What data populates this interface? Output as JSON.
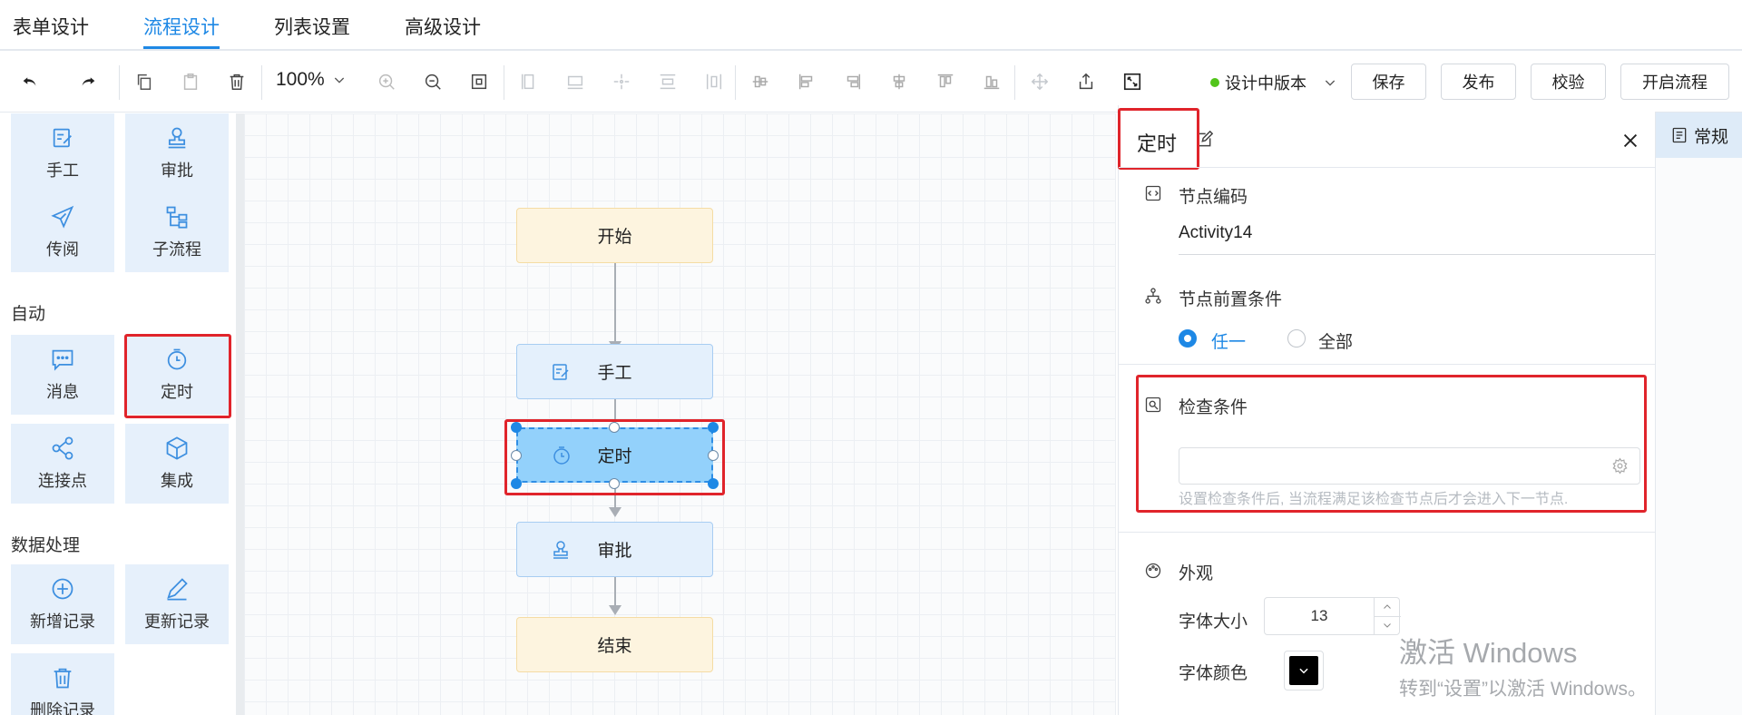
{
  "tabs": [
    {
      "label": "表单设计"
    },
    {
      "label": "流程设计"
    },
    {
      "label": "列表设置"
    },
    {
      "label": "高级设计"
    }
  ],
  "toolbar": {
    "zoom": "100%",
    "version": "设计中版本",
    "buttons": [
      "保存",
      "发布",
      "校验",
      "开启流程"
    ]
  },
  "palette": {
    "items_top": [
      {
        "label": "手工",
        "icon": "edit-icon"
      },
      {
        "label": "审批",
        "icon": "stamp-icon"
      },
      {
        "label": "传阅",
        "icon": "send-icon"
      },
      {
        "label": "子流程",
        "icon": "subflow-icon"
      }
    ],
    "section_auto": "自动",
    "items_auto": [
      {
        "label": "消息",
        "icon": "message-icon"
      },
      {
        "label": "定时",
        "icon": "timer-icon"
      },
      {
        "label": "连接点",
        "icon": "share-icon"
      },
      {
        "label": "集成",
        "icon": "cube-icon"
      }
    ],
    "section_data": "数据处理",
    "items_data": [
      {
        "label": "新增记录",
        "icon": "plus-circle-icon"
      },
      {
        "label": "更新记录",
        "icon": "pen-icon"
      },
      {
        "label": "删除记录",
        "icon": "trash-icon"
      }
    ]
  },
  "flow": {
    "nodes": [
      {
        "label": "开始"
      },
      {
        "label": "手工"
      },
      {
        "label": "定时"
      },
      {
        "label": "审批"
      },
      {
        "label": "结束"
      }
    ]
  },
  "panel": {
    "title": "定时",
    "code_label": "节点编码",
    "code_value": "Activity14",
    "precondition_label": "节点前置条件",
    "option_any": "任一",
    "option_all": "全部",
    "check_label": "检查条件",
    "check_placeholder": "",
    "check_hint": "设置检查条件后, 当流程满足该检查节点后才会进入下一节点.",
    "appearance_label": "外观",
    "font_size_label": "字体大小",
    "font_size_value": "13",
    "font_color_label": "字体颜色"
  },
  "rail": {
    "tab": "常规"
  },
  "watermark": {
    "line1": "激活 Windows",
    "line2": "转到“设置”以激活 Windows。"
  },
  "colors": {
    "accent": "#1e88e5",
    "highlight": "#e0242b",
    "node_selected": "#93d1fb"
  }
}
